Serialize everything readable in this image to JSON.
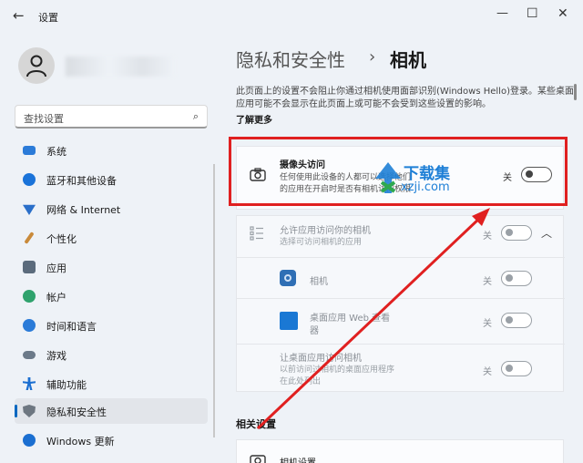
{
  "window": {
    "title": "设置",
    "back_icon": "back-arrow-icon",
    "controls": [
      "minimize-icon",
      "maximize-icon",
      "close-icon"
    ]
  },
  "search": {
    "placeholder": "查找设置",
    "icon": "search-icon"
  },
  "sidebar": {
    "items": [
      {
        "label": "系统",
        "icon": "system-icon",
        "color": "#2b7bd8"
      },
      {
        "label": "蓝牙和其他设备",
        "icon": "bluetooth-icon",
        "color": "#1a73d9"
      },
      {
        "label": "网络 & Internet",
        "icon": "network-icon",
        "color": "#2a6fc9"
      },
      {
        "label": "个性化",
        "icon": "brush-icon",
        "color": "#c98a3a"
      },
      {
        "label": "应用",
        "icon": "apps-icon",
        "color": "#5b6b7c"
      },
      {
        "label": "帐户",
        "icon": "account-icon",
        "color": "#2fa26d"
      },
      {
        "label": "时间和语言",
        "icon": "clock-globe-icon",
        "color": "#2b7bd8"
      },
      {
        "label": "游戏",
        "icon": "gamepad-icon",
        "color": "#6c7a89"
      },
      {
        "label": "辅助功能",
        "icon": "accessibility-icon",
        "color": "#1b6fd1"
      },
      {
        "label": "隐私和安全性",
        "icon": "shield-icon",
        "color": "#6e7781",
        "active": true
      },
      {
        "label": "Windows 更新",
        "icon": "update-icon",
        "color": "#1b6fd1"
      }
    ]
  },
  "breadcrumb": {
    "parent": "隐私和安全性",
    "separator": "›",
    "current": "相机"
  },
  "description": {
    "text": "此页面上的设置不会阻止你通过相机使用面部识别(Windows Hello)登录。某些桌面应用可能不会显示在此页面上或可能不会受到这些设置的影响。",
    "learn_more": "了解更多"
  },
  "camera_access": {
    "title": "摄像头访问",
    "sub1": "任何使用此设备的人都可以选择他们",
    "sub2": "的应用在开启时是否有相机访问权限",
    "state": "关",
    "icon": "camera-icon"
  },
  "app_access": {
    "title": "允许应用访问你的相机",
    "sub": "选择可访问相机的应用",
    "state": "关",
    "icon": "list-icon",
    "expand_icon": "chevron-up-icon"
  },
  "apps": [
    {
      "label": "相机",
      "state": "关",
      "icon": "camera-app-icon",
      "color": "#2f6fb5"
    },
    {
      "label": "桌面应用 Web 查看",
      "label2": "器",
      "state": "关",
      "icon": "webviewer-app-icon",
      "color": "#1a78d4"
    }
  ],
  "desktop_access": {
    "title": "让桌面应用访问相机",
    "sub1": "以前访问过相机的桌面应用程序",
    "sub2": "在此处列出",
    "state": "关"
  },
  "related": {
    "title": "相关设置",
    "item": "相机设置"
  },
  "watermark": {
    "text": "下载集",
    "url": "xzji.com"
  },
  "colors": {
    "accent": "#0067c0",
    "highlight": "#e02020",
    "watermark": "#1e7fd6"
  }
}
